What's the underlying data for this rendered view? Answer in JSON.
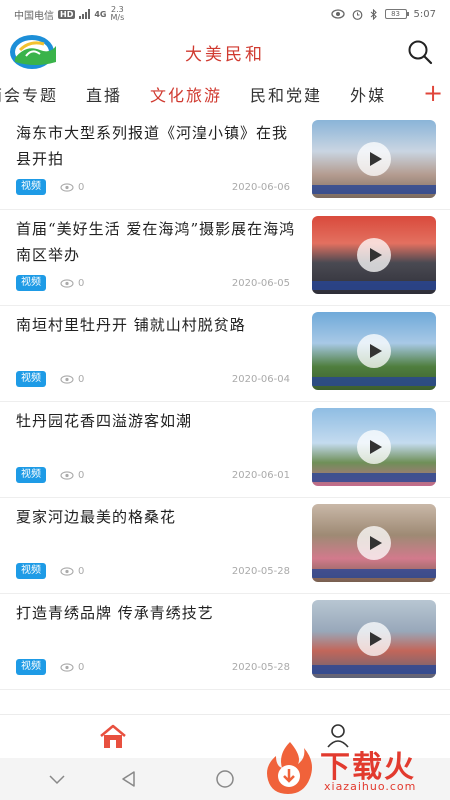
{
  "status_bar": {
    "carrier": "中国电信",
    "hd": "HD",
    "network": "4G",
    "speed_value": "2.3",
    "speed_unit": "M/s",
    "battery": "83",
    "time": "5:07",
    "icons": [
      "eye-icon",
      "alarm-icon",
      "bluetooth-icon",
      "battery-icon"
    ]
  },
  "header": {
    "title": "大美民和",
    "logo_icon": "app-logo-icon",
    "search_icon": "search-icon"
  },
  "tabs": {
    "items": [
      {
        "label": "两会专题"
      },
      {
        "label": "直播"
      },
      {
        "label": "文化旅游"
      },
      {
        "label": "民和党建"
      },
      {
        "label": "外媒"
      }
    ],
    "active_index": 2,
    "add_label": "+"
  },
  "news": [
    {
      "title": "海东市大型系列报道《河湟小镇》在我县开拍",
      "tag": "视频",
      "views": "0",
      "date": "2020-06-06"
    },
    {
      "title": "首届“美好生活 爱在海鸿”摄影展在海鸿南区举办",
      "tag": "视频",
      "views": "0",
      "date": "2020-06-05"
    },
    {
      "title": "南垣村里牡丹开 铺就山村脱贫路",
      "tag": "视频",
      "views": "0",
      "date": "2020-06-04"
    },
    {
      "title": "牡丹园花香四溢游客如潮",
      "tag": "视频",
      "views": "0",
      "date": "2020-06-01"
    },
    {
      "title": "夏家河边最美的格桑花",
      "tag": "视频",
      "views": "0",
      "date": "2020-05-28"
    },
    {
      "title": "打造青绣品牌 传承青绣技艺",
      "tag": "视频",
      "views": "0",
      "date": "2020-05-28"
    }
  ],
  "colors": {
    "accent": "#d03a30",
    "tag_bg": "#1e9be6",
    "meta_text": "#aaaaaa"
  },
  "bottom_nav": {
    "items": [
      {
        "icon": "home-icon",
        "active": true
      },
      {
        "icon": "profile-icon",
        "active": false
      }
    ]
  },
  "system_nav": {
    "icons": [
      "back-chevron-icon",
      "back-triangle-icon",
      "home-circle-icon"
    ]
  },
  "watermark": {
    "text": "下载火",
    "sub": "xiazaihuo.com"
  }
}
